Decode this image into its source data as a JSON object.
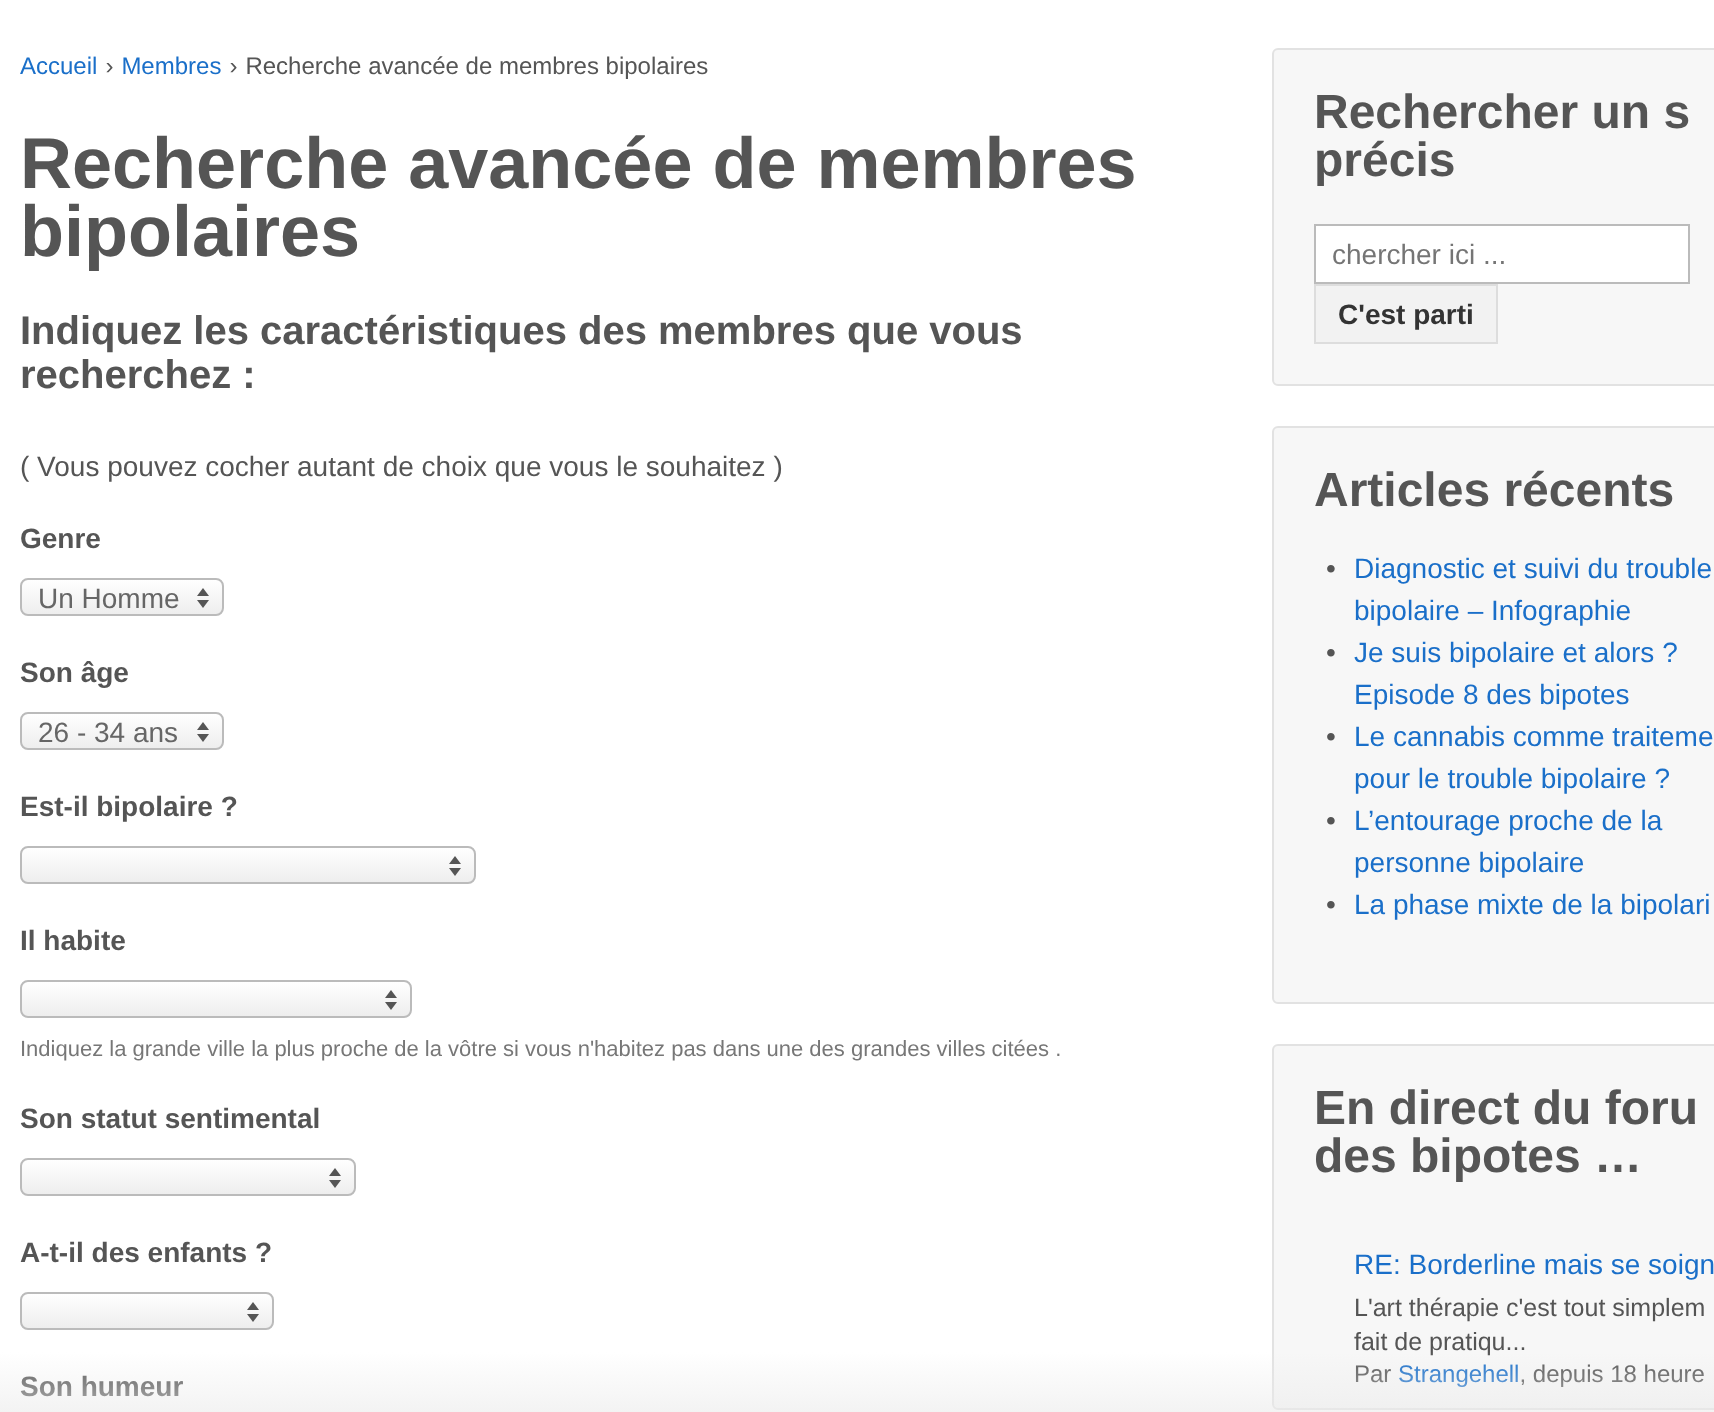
{
  "breadcrumb": [
    {
      "label": "Accueil",
      "link": true
    },
    {
      "label": "Membres",
      "link": true
    },
    {
      "label": "Recherche avancée de membres bipolaires",
      "link": false
    }
  ],
  "breadcrumb_separator": "›",
  "title": "Recherche avancée de membres bipolaires",
  "subtitle": "Indiquez les caractéristiques des membres que vous recherchez :",
  "intro": "( Vous pouvez cocher autant de choix que vous le souhaitez )",
  "fields": [
    {
      "label": "Genre",
      "kind": "select",
      "value": "Un Homme"
    },
    {
      "label": "Son âge",
      "kind": "select",
      "value": "26 - 34 ans"
    },
    {
      "label": "Est-il bipolaire ?",
      "kind": "select"
    },
    {
      "label": "Il habite",
      "kind": "select",
      "help": "Indiquez la grande ville la plus proche de la vôtre si vous n'habitez pas dans une des grandes villes citées ."
    },
    {
      "label": "Son statut sentimental",
      "kind": "select"
    },
    {
      "label": "A-t-il des enfants ?",
      "kind": "select"
    },
    {
      "label": "Son humeur",
      "kind": "label"
    }
  ],
  "sidebar": {
    "search": {
      "title": "Rechercher un s\nprécis",
      "placeholder": "chercher ici ...",
      "button": "C'est parti"
    },
    "recent": {
      "title": "Articles récents",
      "bullet": "•",
      "items": [
        "Diagnostic et suivi du trouble\nbipolaire – Infographie",
        "Je suis bipolaire et alors ?\nEpisode 8 des bipotes",
        "Le cannabis comme traiteme\npour le trouble bipolaire ?",
        "L’entourage proche de la\npersonne bipolaire",
        "La phase mixte de la bipolari"
      ]
    },
    "forum": {
      "title": "En direct du foru\ndes bipotes …",
      "post": {
        "title": "RE: Borderline mais se soign",
        "excerpt": "L'art thérapie c'est tout simplem\nfait de pratiqu...",
        "by": "Par ",
        "author": "Strangehell",
        "time": ", depuis 18 heure"
      }
    }
  }
}
